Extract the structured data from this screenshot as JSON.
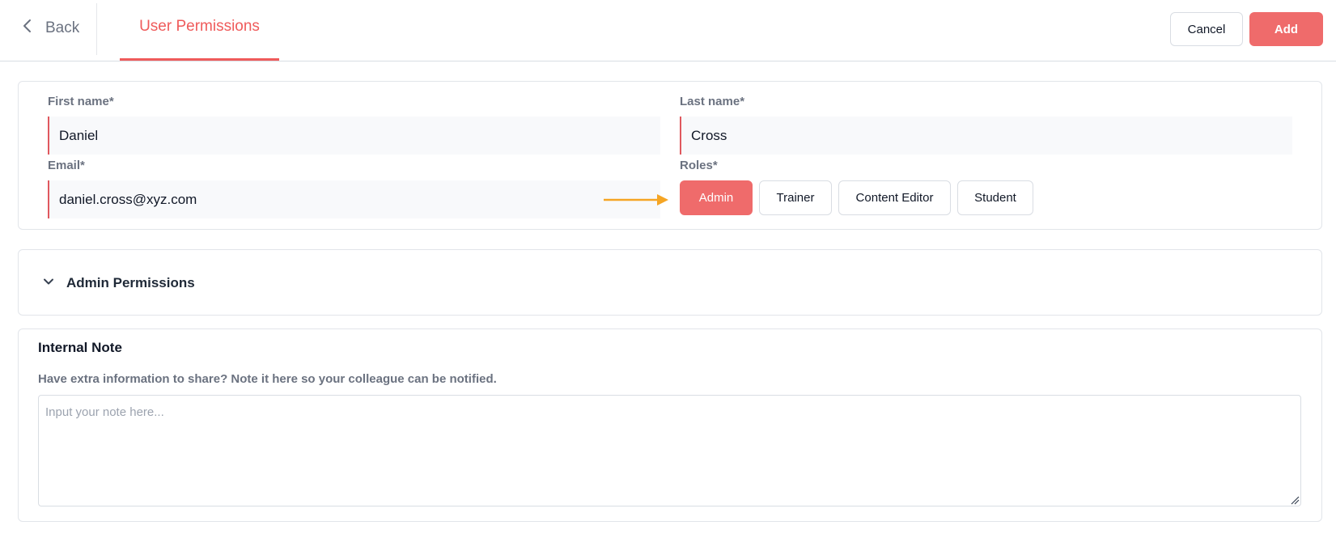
{
  "header": {
    "back_label": "Back",
    "tab_label": "User Permissions",
    "cancel_label": "Cancel",
    "add_label": "Add",
    "accent_color": "#ef6b6b"
  },
  "form": {
    "first_name_label": "First name*",
    "first_name_value": "Daniel",
    "last_name_label": "Last name*",
    "last_name_value": "Cross",
    "email_label": "Email*",
    "email_value": "daniel.cross@xyz.com",
    "roles_label": "Roles*",
    "roles": [
      {
        "label": "Admin",
        "selected": true
      },
      {
        "label": "Trainer",
        "selected": false
      },
      {
        "label": "Content Editor",
        "selected": false
      },
      {
        "label": "Student",
        "selected": false
      }
    ],
    "arrow_icon": "arrow-right-icon",
    "arrow_color": "#f5a524"
  },
  "permissions": {
    "title": "Admin Permissions",
    "expand_icon": "chevron-down-icon"
  },
  "note": {
    "title": "Internal Note",
    "subtitle": "Have extra information to share? Note it here so your colleague can be notified.",
    "placeholder": "Input your note here..."
  }
}
